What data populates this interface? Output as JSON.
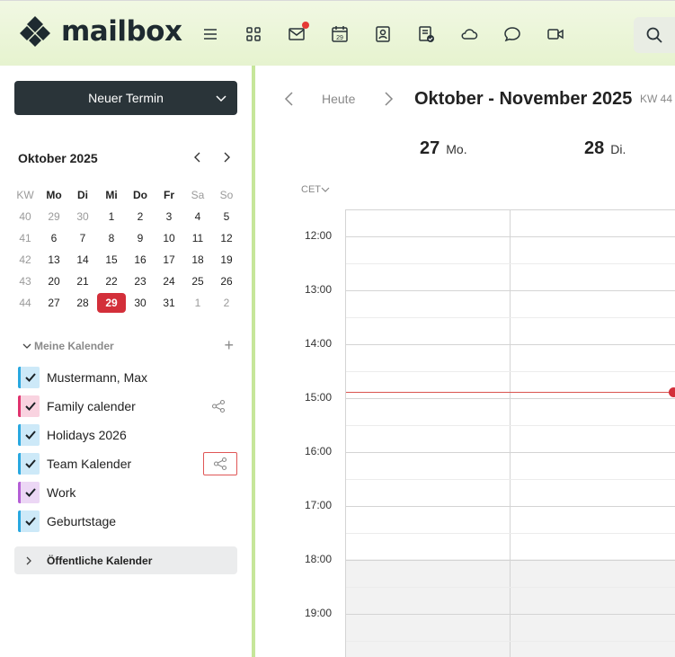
{
  "app": {
    "logo_text": "mailbox"
  },
  "nav": {
    "items": [
      {
        "name": "menu-icon"
      },
      {
        "name": "apps-icon"
      },
      {
        "name": "mail-icon",
        "badge": true
      },
      {
        "name": "calendar-icon",
        "day": "29"
      },
      {
        "name": "contacts-icon"
      },
      {
        "name": "tasks-icon"
      },
      {
        "name": "cloud-icon"
      },
      {
        "name": "chat-icon"
      },
      {
        "name": "video-icon"
      }
    ],
    "search_icon": "search-icon"
  },
  "sidebar": {
    "new_event_label": "Neuer Termin",
    "mini_cal": {
      "title": "Oktober 2025",
      "headers": [
        "KW",
        "Mo",
        "Di",
        "Mi",
        "Do",
        "Fr",
        "Sa",
        "So"
      ],
      "weeks": [
        [
          "40",
          "29",
          "30",
          "1",
          "2",
          "3",
          "4",
          "5"
        ],
        [
          "41",
          "6",
          "7",
          "8",
          "9",
          "10",
          "11",
          "12"
        ],
        [
          "42",
          "13",
          "14",
          "15",
          "16",
          "17",
          "18",
          "19"
        ],
        [
          "43",
          "20",
          "21",
          "22",
          "23",
          "24",
          "25",
          "26"
        ],
        [
          "44",
          "27",
          "28",
          "29",
          "30",
          "31",
          "1",
          "2"
        ]
      ],
      "today": "29"
    },
    "my_calendars_label": "Meine Kalender",
    "calendars": [
      {
        "name": "Mustermann, Max",
        "color": "#29a8e0",
        "bg": "#cde9f8",
        "share": false
      },
      {
        "name": "Family calender",
        "color": "#e0336e",
        "bg": "#f9d3e0",
        "share": true
      },
      {
        "name": "Holidays 2026",
        "color": "#29a8e0",
        "bg": "#cde9f8",
        "share": false
      },
      {
        "name": "Team Kalender",
        "color": "#29a8e0",
        "bg": "#cde9f8",
        "share": true,
        "focused": true
      },
      {
        "name": "Work",
        "color": "#b45fd6",
        "bg": "#ecd7f5",
        "share": false
      },
      {
        "name": "Geburtstage",
        "color": "#29a8e0",
        "bg": "#cde9f8",
        "share": false
      }
    ],
    "public_calendars_label": "Öffentliche Kalender"
  },
  "main": {
    "today_label": "Heute",
    "range_title": "Oktober - November 2025",
    "kw_label": "KW 44",
    "days": [
      {
        "num": "27",
        "name": "Mo."
      },
      {
        "num": "28",
        "name": "Di."
      }
    ],
    "timezone": "CET",
    "hours": [
      "12:00",
      "13:00",
      "14:00",
      "15:00",
      "16:00",
      "17:00",
      "18:00",
      "19:00"
    ]
  }
}
